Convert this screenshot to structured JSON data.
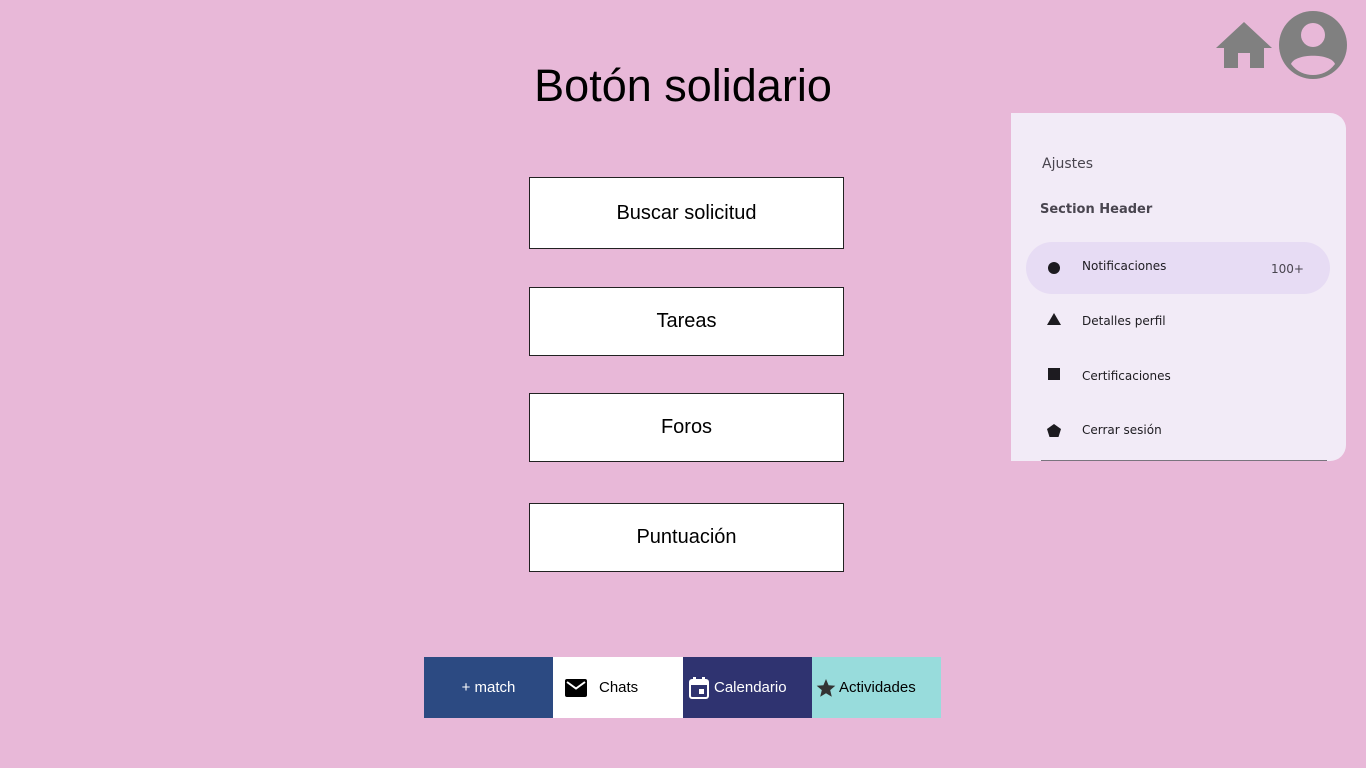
{
  "header": {
    "title": "Botón solidario",
    "home_icon": "home-icon",
    "account_icon": "account-circle-icon"
  },
  "main_menu": [
    {
      "label": "Buscar solicitud"
    },
    {
      "label": "Tareas"
    },
    {
      "label": "Foros"
    },
    {
      "label": "Puntuación"
    }
  ],
  "drawer": {
    "headline": "Ajustes",
    "section_header": "Section Header",
    "items": [
      {
        "label": "Notificaciones",
        "icon": "circle-icon",
        "badge": "100+",
        "active": true
      },
      {
        "label": "Detalles perfil",
        "icon": "triangle-icon",
        "badge": "",
        "active": false
      },
      {
        "label": "Certificaciones",
        "icon": "square-icon",
        "badge": "",
        "active": false
      },
      {
        "label": "Cerrar sesión",
        "icon": "pentagon-icon",
        "badge": "",
        "active": false
      }
    ]
  },
  "bottom_nav": {
    "tabs": [
      {
        "label": "+ match",
        "icon": "",
        "color": "#2c4a82"
      },
      {
        "label": "Chats",
        "icon": "mail-icon",
        "color": "#ffffff"
      },
      {
        "label": "Calendario",
        "icon": "calendar-icon",
        "color": "#2f3370"
      },
      {
        "label": "Actividades",
        "icon": "star-icon",
        "color": "#98dcdc"
      }
    ]
  },
  "colors": {
    "background": "#e8b8d8",
    "drawer_background": "#f2ebf7",
    "drawer_active": "#e7dcf4",
    "icon_gray": "#808080"
  }
}
